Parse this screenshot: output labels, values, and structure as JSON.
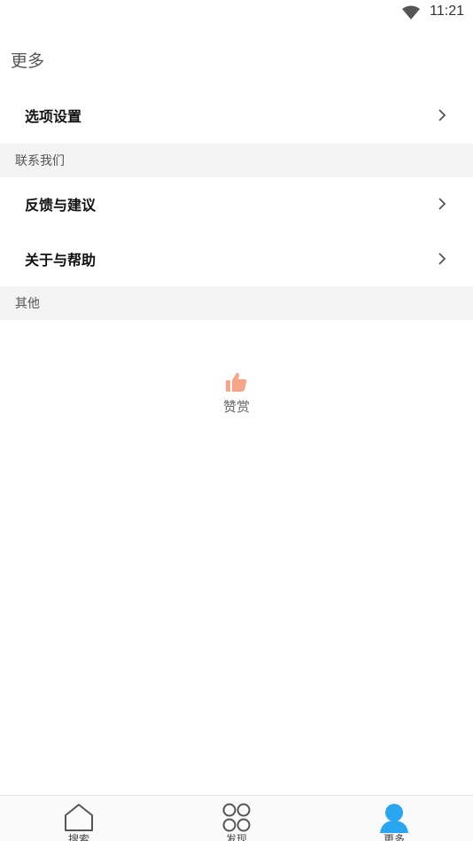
{
  "status_bar": {
    "time": "11:21",
    "wifi_icon": "wifi-icon"
  },
  "page": {
    "title": "更多"
  },
  "settings": {
    "label": "选项设置",
    "icon": "chevron-right-icon"
  },
  "sections": {
    "contact": "联系我们",
    "other": "其他"
  },
  "contact_items": [
    {
      "label": "反馈与建议",
      "icon": "chevron-right-icon"
    },
    {
      "label": "关于与帮助",
      "icon": "chevron-right-icon"
    }
  ],
  "reward": {
    "label": "赞赏",
    "icon": "thumbs-up-icon",
    "color": "#f6a48a"
  },
  "bottom_nav": {
    "items": [
      {
        "label": "搜索",
        "icon": "home-icon",
        "active": false
      },
      {
        "label": "发现",
        "icon": "four-circles-icon",
        "active": false
      },
      {
        "label": "更多",
        "icon": "user-icon",
        "active": true
      }
    ],
    "active_color": "#2aa6f0",
    "inactive_color": "#555555"
  },
  "colors": {
    "section_bg": "#f3f3f3",
    "background": "#ffffff"
  }
}
